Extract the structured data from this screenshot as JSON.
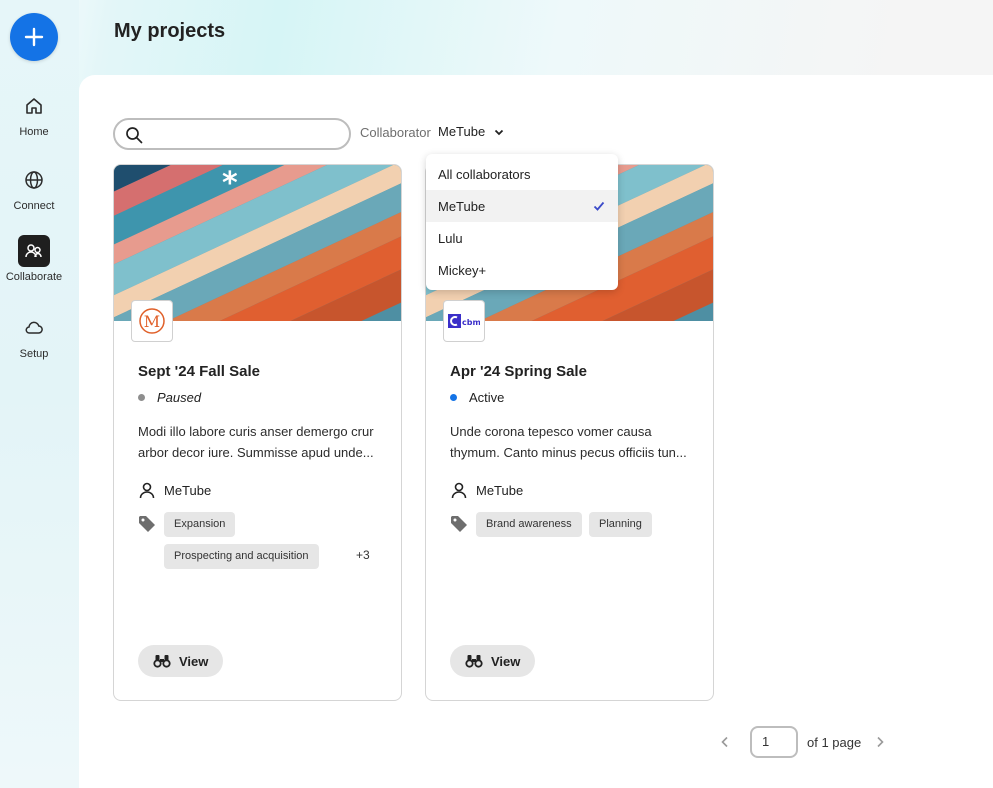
{
  "header": {
    "title": "My projects"
  },
  "sidebar": {
    "items": [
      {
        "label": "Home",
        "icon": "home-icon"
      },
      {
        "label": "Connect",
        "icon": "globe-icon"
      },
      {
        "label": "Collaborate",
        "icon": "collaborate-icon",
        "active": true
      },
      {
        "label": "Setup",
        "icon": "cloud-icon"
      }
    ]
  },
  "filters": {
    "search_placeholder": "",
    "collaborator_label": "Collaborator",
    "collaborator_value": "MeTube"
  },
  "dropdown": {
    "options": [
      "All collaborators",
      "MeTube",
      "Lulu",
      "Mickey+"
    ],
    "selected": "MeTube"
  },
  "cards": [
    {
      "title": "Sept '24 Fall Sale",
      "status": "Paused",
      "status_color": "#8e8e8e",
      "description": "Modi illo labore curis anser demergo crur arbor decor iure. Summisse apud unde...",
      "owner": "MeTube",
      "tags": [
        "Expansion",
        "Prospecting and acquisition"
      ],
      "more_tags": "+3",
      "view_label": "View",
      "logo": "M"
    },
    {
      "title": "Apr '24 Spring Sale",
      "status": "Active",
      "status_color": "#1473e6",
      "description": "Unde corona tepesco vomer causa thymum. Canto minus pecus officiis tun...",
      "owner": "MeTube",
      "tags": [
        "Brand awareness",
        "Planning"
      ],
      "view_label": "View",
      "logo": "cbm"
    }
  ],
  "pagination": {
    "current": "1",
    "total_text": "of 1 page"
  },
  "colors": {
    "accent": "#1473e6",
    "active_nav": "#1f1f1f"
  }
}
